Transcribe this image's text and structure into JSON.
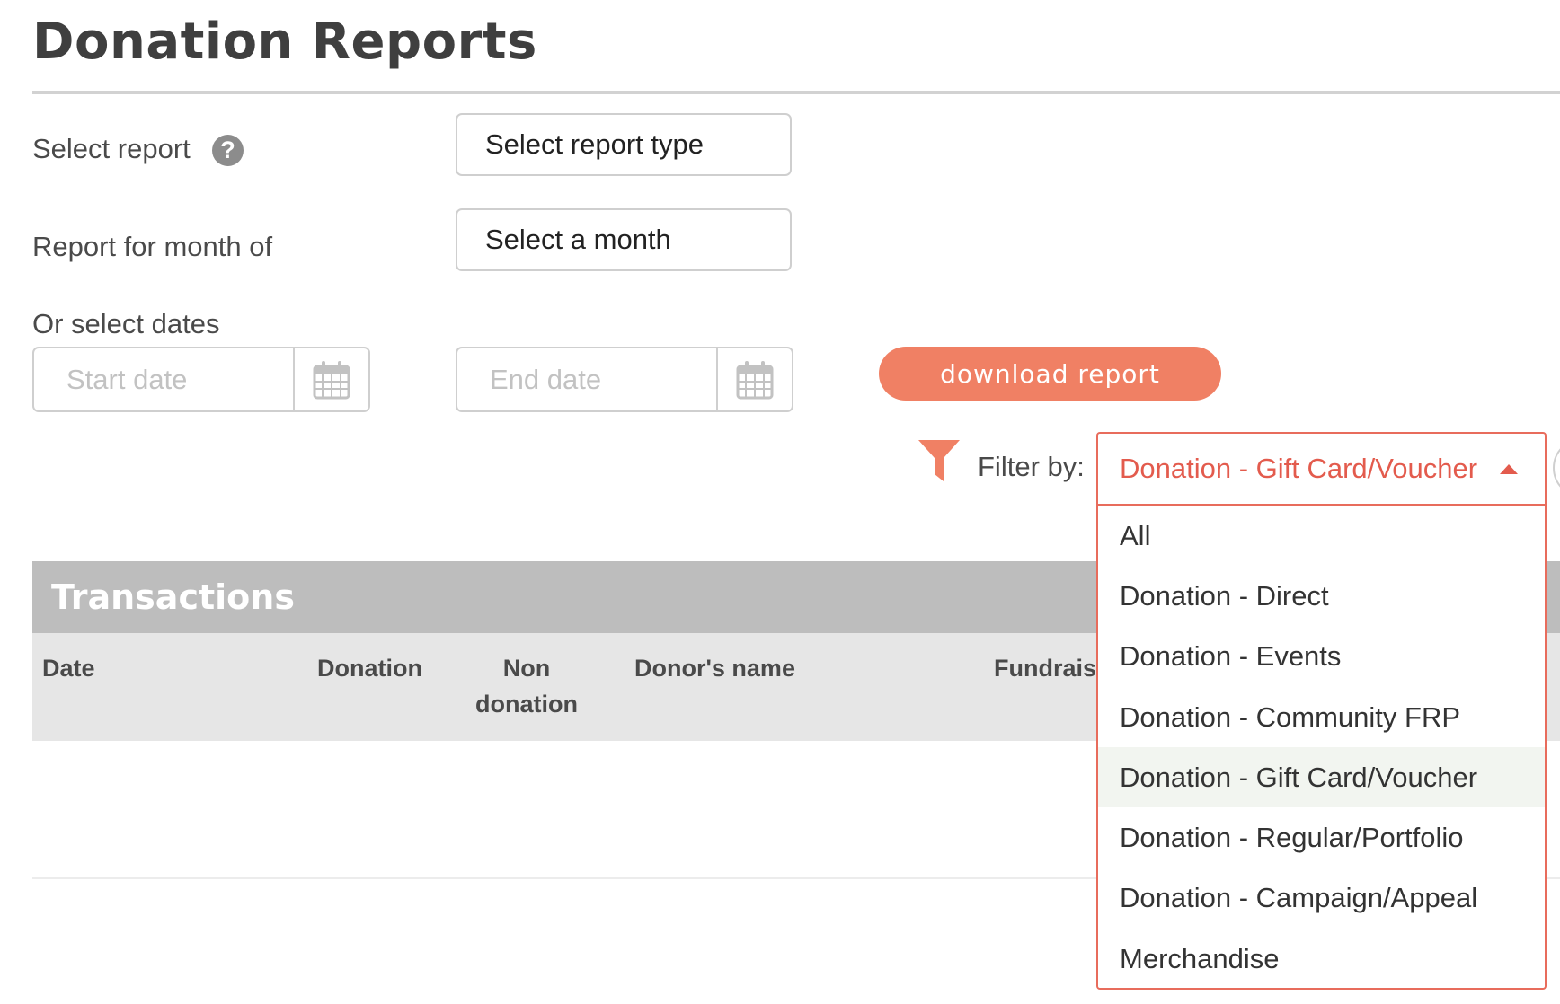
{
  "page": {
    "title": "Donation Reports"
  },
  "form": {
    "select_report_label": "Select report",
    "help_icon_glyph": "?",
    "report_type_value": "Select report type",
    "month_label": "Report for month of",
    "month_value": "Select a month",
    "dates_label": "Or select dates",
    "start_date_placeholder": "Start date",
    "end_date_placeholder": "End date",
    "calendar_icon": "calendar-icon"
  },
  "download": {
    "label": "download report",
    "color": "#f08064"
  },
  "filter": {
    "icon": "funnel-icon",
    "label": "Filter by:",
    "selected": "Donation - Gift Card/Voucher",
    "accent_color": "#e35b4d",
    "expanded": true,
    "options": [
      "All",
      "Donation - Direct",
      "Donation - Events",
      "Donation - Community FRP",
      "Donation - Gift Card/Voucher",
      "Donation - Regular/Portfolio",
      "Donation - Campaign/Appeal",
      "Merchandise"
    ]
  },
  "transactions": {
    "title": "Transactions",
    "columns": {
      "date": "Date",
      "donation": "Donation",
      "non_donation_line1": "Non",
      "non_donation_line2": "donation",
      "donor_name": "Donor's name",
      "fundraiser_partial": "Fundrais"
    }
  }
}
